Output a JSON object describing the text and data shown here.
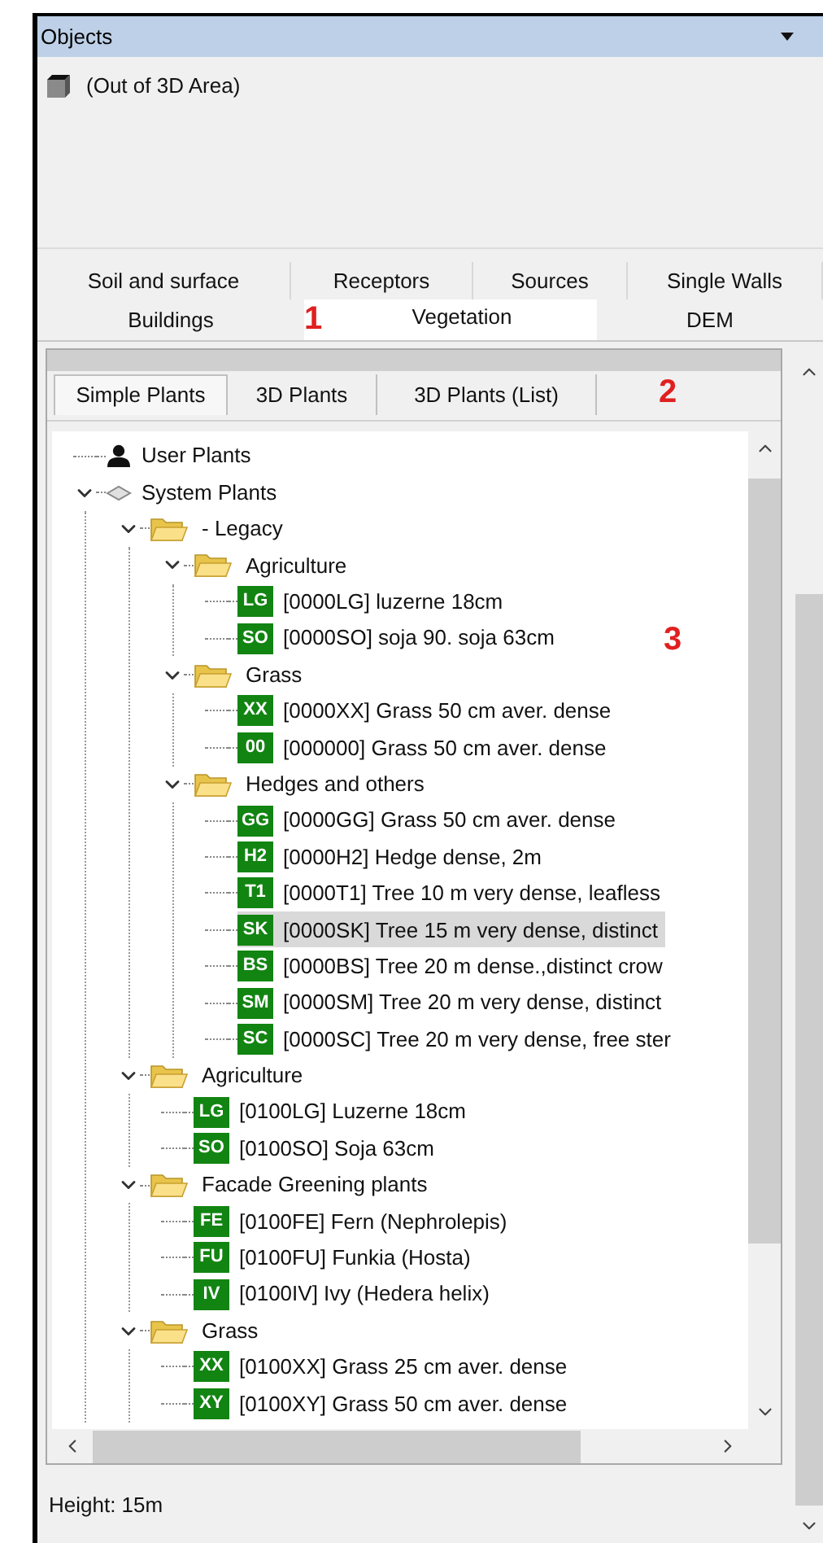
{
  "panel": {
    "title": "Objects"
  },
  "objects_list": [
    {
      "label": "(Out of 3D Area)"
    }
  ],
  "tabs_row_1": [
    {
      "label": "Soil and surface",
      "selected": false
    },
    {
      "label": "Receptors",
      "selected": false
    },
    {
      "label": "Sources",
      "selected": false
    },
    {
      "label": "Single Walls",
      "selected": false
    }
  ],
  "tabs_row_2": [
    {
      "label": "Buildings",
      "selected": false
    },
    {
      "label": "Vegetation",
      "selected": true
    },
    {
      "label": "DEM",
      "selected": false
    }
  ],
  "subtabs": [
    {
      "label": "Simple Plants",
      "selected": true
    },
    {
      "label": "3D Plants",
      "selected": false
    },
    {
      "label": "3D Plants (List)",
      "selected": false
    }
  ],
  "tree": [
    {
      "kind": "user",
      "label": "User Plants"
    },
    {
      "kind": "system",
      "label": "System Plants",
      "expanded": true,
      "children": [
        {
          "kind": "folder",
          "label": "- Legacy",
          "expanded": true,
          "children": [
            {
              "kind": "folder",
              "label": "Agriculture",
              "expanded": true,
              "children": [
                {
                  "kind": "plant",
                  "code": "LG",
                  "label": "[0000LG] luzerne 18cm",
                  "selected": false
                },
                {
                  "kind": "plant",
                  "code": "SO",
                  "label": "[0000SO] soja 90. soja 63cm",
                  "selected": false
                }
              ]
            },
            {
              "kind": "folder",
              "label": "Grass",
              "expanded": true,
              "children": [
                {
                  "kind": "plant",
                  "code": "XX",
                  "label": "[0000XX] Grass 50 cm aver. dense",
                  "selected": false
                },
                {
                  "kind": "plant",
                  "code": "00",
                  "label": "[000000] Grass 50 cm aver. dense",
                  "selected": false
                }
              ]
            },
            {
              "kind": "folder",
              "label": "Hedges and others",
              "expanded": true,
              "children": [
                {
                  "kind": "plant",
                  "code": "GG",
                  "label": "[0000GG] Grass 50 cm aver. dense",
                  "selected": false
                },
                {
                  "kind": "plant",
                  "code": "H2",
                  "label": "[0000H2] Hedge dense, 2m",
                  "selected": false
                },
                {
                  "kind": "plant",
                  "code": "T1",
                  "label": "[0000T1] Tree 10 m very dense, leafless",
                  "selected": false
                },
                {
                  "kind": "plant",
                  "code": "SK",
                  "label": "[0000SK] Tree 15 m very dense, distinct",
                  "selected": true
                },
                {
                  "kind": "plant",
                  "code": "BS",
                  "label": "[0000BS] Tree 20 m dense.,distinct crow",
                  "selected": false
                },
                {
                  "kind": "plant",
                  "code": "SM",
                  "label": "[0000SM] Tree 20 m very dense, distinct",
                  "selected": false
                },
                {
                  "kind": "plant",
                  "code": "SC",
                  "label": "[0000SC] Tree 20 m very dense, free ster",
                  "selected": false
                }
              ]
            }
          ]
        },
        {
          "kind": "folder",
          "label": "Agriculture",
          "expanded": true,
          "children": [
            {
              "kind": "plant",
              "code": "LG",
              "label": "[0100LG] Luzerne 18cm",
              "selected": false
            },
            {
              "kind": "plant",
              "code": "SO",
              "label": "[0100SO] Soja 63cm",
              "selected": false
            }
          ]
        },
        {
          "kind": "folder",
          "label": "Facade Greening plants",
          "expanded": true,
          "children": [
            {
              "kind": "plant",
              "code": "FE",
              "label": "[0100FE] Fern (Nephrolepis)",
              "selected": false
            },
            {
              "kind": "plant",
              "code": "FU",
              "label": "[0100FU] Funkia (Hosta)",
              "selected": false
            },
            {
              "kind": "plant",
              "code": "IV",
              "label": "[0100IV] Ivy (Hedera helix)",
              "selected": false
            }
          ]
        },
        {
          "kind": "folder",
          "label": "Grass",
          "expanded": true,
          "children": [
            {
              "kind": "plant",
              "code": "XX",
              "label": "[0100XX] Grass 25 cm aver. dense",
              "selected": false
            },
            {
              "kind": "plant",
              "code": "XY",
              "label": "[0100XY] Grass 50 cm aver. dense",
              "selected": false
            }
          ]
        }
      ]
    }
  ],
  "status": "Height: 15m",
  "annotations": [
    {
      "label": "1"
    },
    {
      "label": "2"
    },
    {
      "label": "3"
    }
  ]
}
